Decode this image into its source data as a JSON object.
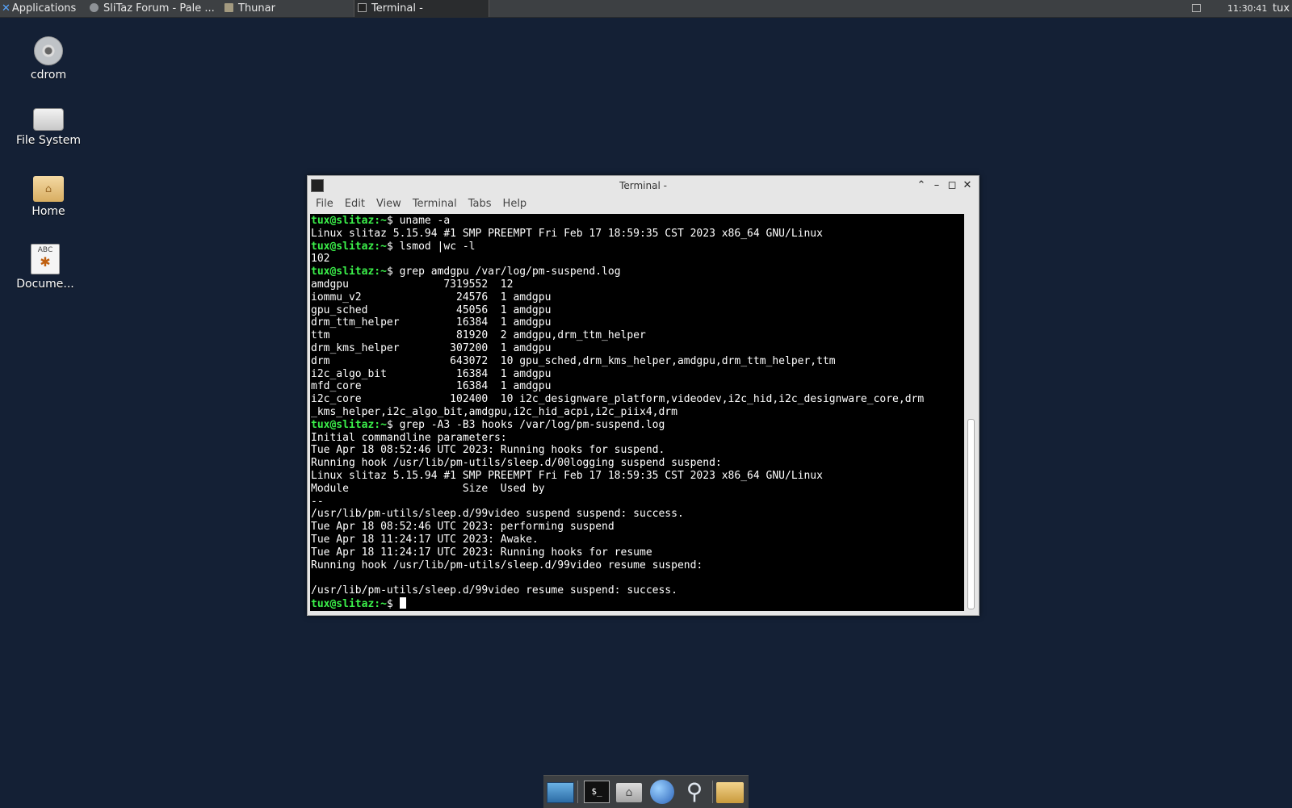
{
  "top_panel": {
    "applications_label": "Applications",
    "tasks": [
      {
        "label": "SliTaz Forum - Pale ...",
        "icon": "globe-icon"
      },
      {
        "label": "Thunar",
        "icon": "folder-icon"
      },
      {
        "label": "Terminal -",
        "icon": "terminal-icon"
      }
    ],
    "clock": "11:30:41",
    "user": "tux"
  },
  "desktop_icons": [
    {
      "label": "cdrom",
      "icon": "cdrom-icon"
    },
    {
      "label": "File System",
      "icon": "drive-icon"
    },
    {
      "label": "Home",
      "icon": "home-folder-icon"
    },
    {
      "label": "Docume...",
      "icon": "document-icon",
      "icon_text": "ABC"
    }
  ],
  "terminal": {
    "title": "Terminal -",
    "menu": [
      "File",
      "Edit",
      "View",
      "Terminal",
      "Tabs",
      "Help"
    ],
    "prompt": "tux@slitaz",
    "prompt_suffix": ":~$",
    "lines": [
      {
        "type": "cmd",
        "text": " uname -a"
      },
      {
        "type": "out",
        "text": "Linux slitaz 5.15.94 #1 SMP PREEMPT Fri Feb 17 18:59:35 CST 2023 x86_64 GNU/Linux"
      },
      {
        "type": "cmd",
        "text": " lsmod |wc -l"
      },
      {
        "type": "out",
        "text": "102"
      },
      {
        "type": "cmd",
        "text": " grep amdgpu /var/log/pm-suspend.log"
      },
      {
        "type": "out",
        "text": "amdgpu               7319552  12"
      },
      {
        "type": "out",
        "text": "iommu_v2               24576  1 amdgpu"
      },
      {
        "type": "out",
        "text": "gpu_sched              45056  1 amdgpu"
      },
      {
        "type": "out",
        "text": "drm_ttm_helper         16384  1 amdgpu"
      },
      {
        "type": "out",
        "text": "ttm                    81920  2 amdgpu,drm_ttm_helper"
      },
      {
        "type": "out",
        "text": "drm_kms_helper        307200  1 amdgpu"
      },
      {
        "type": "out",
        "text": "drm                   643072  10 gpu_sched,drm_kms_helper,amdgpu,drm_ttm_helper,ttm"
      },
      {
        "type": "out",
        "text": "i2c_algo_bit           16384  1 amdgpu"
      },
      {
        "type": "out",
        "text": "mfd_core               16384  1 amdgpu"
      },
      {
        "type": "out",
        "text": "i2c_core              102400  10 i2c_designware_platform,videodev,i2c_hid,i2c_designware_core,drm"
      },
      {
        "type": "out",
        "text": "_kms_helper,i2c_algo_bit,amdgpu,i2c_hid_acpi,i2c_piix4,drm"
      },
      {
        "type": "cmd",
        "text": " grep -A3 -B3 hooks /var/log/pm-suspend.log"
      },
      {
        "type": "out",
        "text": "Initial commandline parameters:"
      },
      {
        "type": "out",
        "text": "Tue Apr 18 08:52:46 UTC 2023: Running hooks for suspend."
      },
      {
        "type": "out",
        "text": "Running hook /usr/lib/pm-utils/sleep.d/00logging suspend suspend:"
      },
      {
        "type": "out",
        "text": "Linux slitaz 5.15.94 #1 SMP PREEMPT Fri Feb 17 18:59:35 CST 2023 x86_64 GNU/Linux"
      },
      {
        "type": "out",
        "text": "Module                  Size  Used by"
      },
      {
        "type": "out",
        "text": "--"
      },
      {
        "type": "out",
        "text": "/usr/lib/pm-utils/sleep.d/99video suspend suspend: success."
      },
      {
        "type": "out",
        "text": "Tue Apr 18 08:52:46 UTC 2023: performing suspend"
      },
      {
        "type": "out",
        "text": "Tue Apr 18 11:24:17 UTC 2023: Awake."
      },
      {
        "type": "out",
        "text": "Tue Apr 18 11:24:17 UTC 2023: Running hooks for resume"
      },
      {
        "type": "out",
        "text": "Running hook /usr/lib/pm-utils/sleep.d/99video resume suspend:"
      },
      {
        "type": "out",
        "text": ""
      },
      {
        "type": "out",
        "text": "/usr/lib/pm-utils/sleep.d/99video resume suspend: success."
      },
      {
        "type": "cmd",
        "text": " "
      }
    ]
  },
  "dock": {
    "items": [
      "desktop-icon",
      "terminal-icon",
      "home-icon",
      "web-browser-icon",
      "search-icon",
      "file-manager-icon"
    ],
    "terminal_glyph": "$_"
  },
  "colors": {
    "desktop_bg": "#142035",
    "prompt_green": "#3bf04a",
    "panel_bg": "#3d4043"
  }
}
